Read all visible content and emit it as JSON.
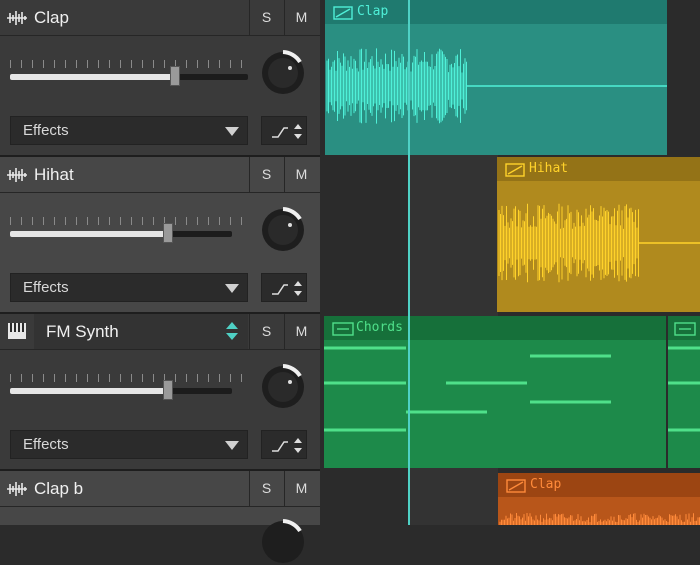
{
  "tracks": [
    {
      "name": "Clap",
      "solo": "S",
      "mute": "M",
      "effects": "Effects",
      "icon": "waveform-icon",
      "volume": 0.7,
      "knob": 0.45
    },
    {
      "name": "Hihat",
      "solo": "S",
      "mute": "M",
      "effects": "Effects",
      "icon": "waveform-icon",
      "volume": 0.68,
      "knob": 0.45
    },
    {
      "name": "FM Synth",
      "solo": "S",
      "mute": "M",
      "effects": "Effects",
      "icon": "piano-keys-icon",
      "volume": 0.68,
      "knob": 0.45
    },
    {
      "name": "Clap b",
      "solo": "S",
      "mute": "M",
      "icon": "waveform-icon"
    }
  ],
  "clips": [
    {
      "name": "Clap",
      "type": "audio",
      "color": "#2a8f82",
      "header": "#1f7a6f",
      "accent": "#4ff0d8"
    },
    {
      "name": "Hihat",
      "type": "audio",
      "color": "#b08a1e",
      "header": "#947317",
      "accent": "#ffd22a"
    },
    {
      "name": "Chords",
      "type": "midi",
      "color": "#1d8a4a",
      "header": "#16703a",
      "accent": "#4fe08a"
    },
    {
      "name": "Clap",
      "type": "audio",
      "color": "#b8561a",
      "header": "#9c4512",
      "accent": "#ff8a3a"
    }
  ],
  "colors": {
    "playhead": "#4fd1c5",
    "selected_up_down": "#4fd1c5"
  }
}
